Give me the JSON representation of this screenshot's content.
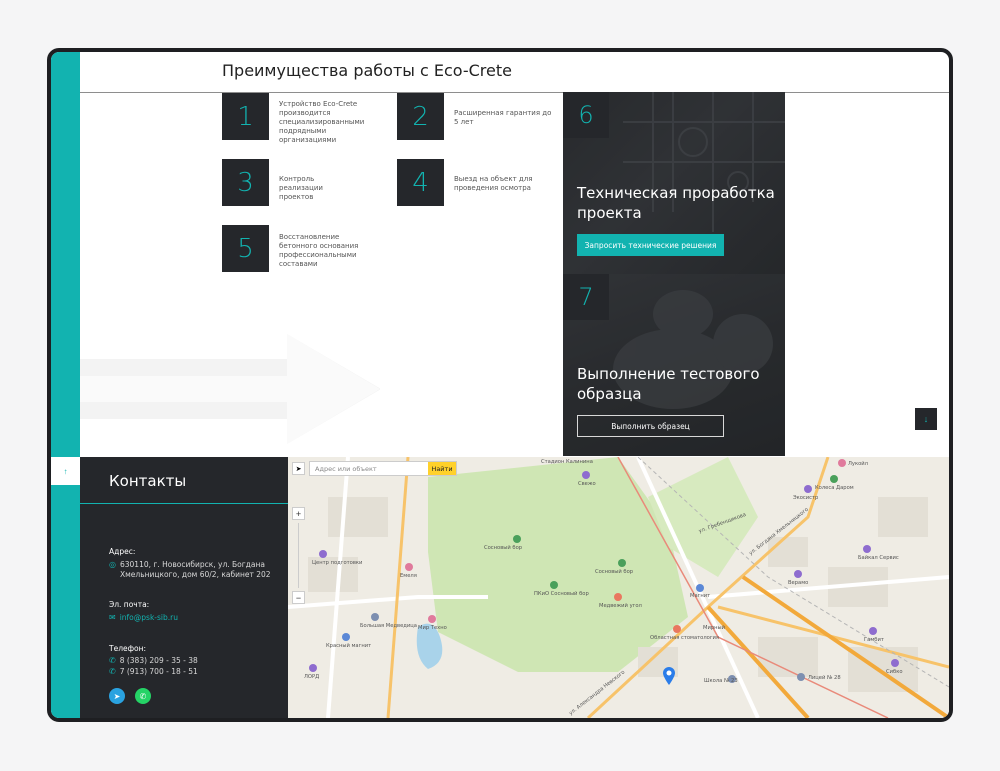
{
  "advantages": {
    "title": "Преимущества работы с Eco-Crete",
    "items": [
      {
        "num": "1",
        "text": "Устройство Eco-Crete производится специализированными подрядными организациями"
      },
      {
        "num": "2",
        "text": "Расширенная гарантия до 5 лет"
      },
      {
        "num": "3",
        "text": "Контроль реализации проектов"
      },
      {
        "num": "4",
        "text": "Выезд на объект для проведения осмотра"
      },
      {
        "num": "5",
        "text": "Восстановление бетонного основания профессиональными составами"
      }
    ],
    "cards": [
      {
        "num": "6",
        "title": "Техническая проработка проекта",
        "button": "Запросить технические решения"
      },
      {
        "num": "7",
        "title": "Выполнение тестового образца",
        "button": "Выполнить образец"
      }
    ]
  },
  "nav": {
    "up_icon": "arrow-up-icon",
    "down_icon": "arrow-down-icon"
  },
  "contacts": {
    "title": "Контакты",
    "address_label": "Адрес:",
    "address": "630110, г. Новосибирск, ул. Богдана Хмельницкого, дом 60/2, кабинет 202",
    "email_label": "Эл. почта:",
    "email": "info@psk-sib.ru",
    "phone_label": "Телефон:",
    "phones": [
      "8 (383) 209 - 35 - 38",
      "7 (913) 700 - 18 - 51"
    ],
    "social": [
      "telegram-icon",
      "whatsapp-icon"
    ]
  },
  "map": {
    "search_placeholder": "Адрес или объект",
    "find_label": "Найти",
    "labels": {
      "l1": "Центр подготовки",
      "l2": "Сосновый бор",
      "l3": "Сосновый бор",
      "l4": "ПКиО Сосновый бор",
      "l5": "Медвежий угол",
      "l6": "Мир Техно",
      "l7": "Большая Медведица",
      "l8": "Красный магнит",
      "l9": "Емеля",
      "l10": "Областная стоматология",
      "l11": "Магнит",
      "l12": "Школа № 23",
      "l13": "Лицей № 28",
      "l14": "Колеса Даром",
      "l15": "Экосистр",
      "l16": "Байкал Сервис",
      "l17": "Верамо",
      "l18": "Гамбит",
      "l19": "Сибко",
      "l20": "Лукойл",
      "l21": "Свежо",
      "l22": "Стадион Калинина",
      "l23": "ул. Богдана Хмельницкого",
      "l24": "ул. Александра Невского",
      "l25": "ул. Гребенщикова",
      "l26": "Мирный",
      "l27": "ЛОРД"
    },
    "colors": {
      "park": "#cfe6b4",
      "road": "#f7c36a",
      "main_road": "#f2a93b",
      "water": "#a9d3ea"
    }
  },
  "colors": {
    "teal": "#12b3b0",
    "dark": "#25272b"
  }
}
